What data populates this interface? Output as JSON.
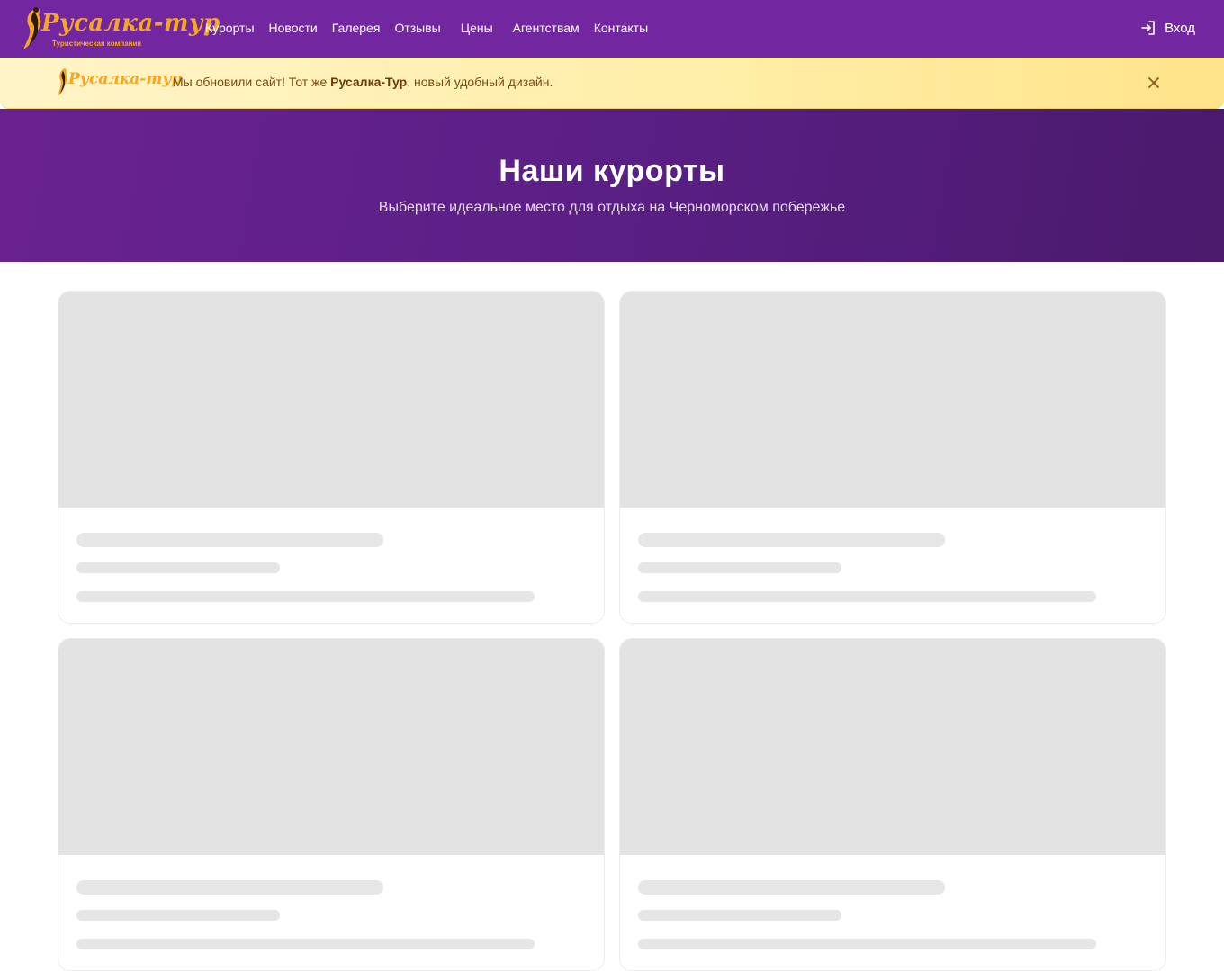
{
  "header": {
    "logo_text": "Русалка-тур",
    "logo_subtitle": "Туристическая компания",
    "nav": [
      {
        "label": "Курорты"
      },
      {
        "label": "Новости"
      },
      {
        "label": "Галерея"
      },
      {
        "label": "Отзывы"
      },
      {
        "label": "Цены"
      },
      {
        "label": "Агентствам"
      },
      {
        "label": "Контакты"
      }
    ],
    "login_label": "Вход",
    "brand_color": "#7226a0",
    "logo_color": "#f5a623"
  },
  "notice": {
    "logo_text": "Русалка-тур",
    "text_before": "Мы обновили сайт! Тот же ",
    "text_bold": "Русалка-Тур",
    "text_after": ", новый удобный дизайн.",
    "close_icon": "close-icon"
  },
  "hero": {
    "title": "Наши курорты",
    "subtitle": "Выберите идеальное место для отдыха на Черноморском побережье"
  },
  "cards": [
    {
      "state": "loading"
    },
    {
      "state": "loading"
    },
    {
      "state": "loading"
    },
    {
      "state": "loading"
    }
  ]
}
